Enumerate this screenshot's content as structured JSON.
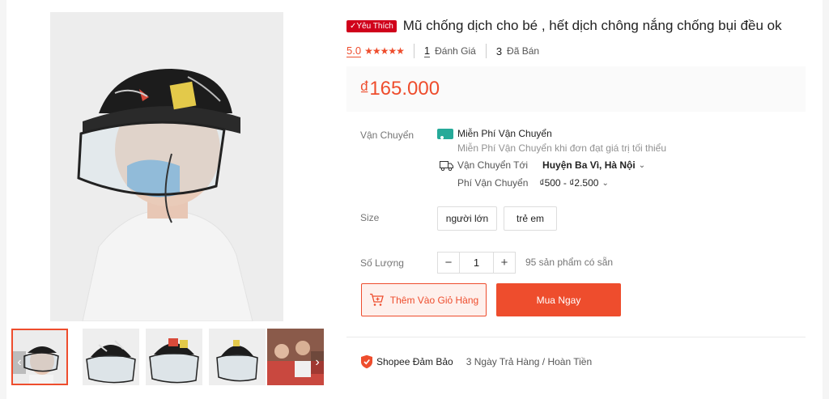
{
  "product": {
    "badge": "Yêu Thích",
    "title": "Mũ chống dịch cho bé , hết dịch chông nắng chống bụi đều ok",
    "rating": "5.0",
    "reviews_count": "1",
    "reviews_label": "Đánh Giá",
    "sold_count": "3",
    "sold_label": "Đã Bán",
    "price": "₫165.000"
  },
  "shipping": {
    "label": "Vận Chuyển",
    "free_title": "Miễn Phí Vận Chuyển",
    "free_note": "Miễn Phí Vận Chuyển khi đơn đạt giá trị tối thiểu",
    "to_label": "Vận Chuyển Tới",
    "destination": "Huyện Ba Vì, Hà Nội",
    "fee_label": "Phí Vận Chuyển",
    "fee_range": "₫500 - ₫2.500"
  },
  "size": {
    "label": "Size",
    "options": [
      "người lớn",
      "trẻ em"
    ]
  },
  "quantity": {
    "label": "Số Lượng",
    "value": "1",
    "minus": "−",
    "plus": "+",
    "stock": "95 sản phẩm có sẵn"
  },
  "actions": {
    "add_to_cart": "Thêm Vào Giỏ Hàng",
    "buy_now": "Mua Ngay"
  },
  "guarantee": {
    "title": "Shopee Đảm Bảo",
    "text": "3 Ngày Trả Hàng / Hoàn Tiền"
  },
  "colors": {
    "accent": "#ee4d2d",
    "badge": "#d0011b",
    "free_ship": "#26aa99"
  },
  "icons": [
    "check-icon",
    "star-icon",
    "free-shipping-icon",
    "truck-icon",
    "chevron-down-icon",
    "cart-icon",
    "shield-icon",
    "arrow-left-icon",
    "arrow-right-icon"
  ]
}
